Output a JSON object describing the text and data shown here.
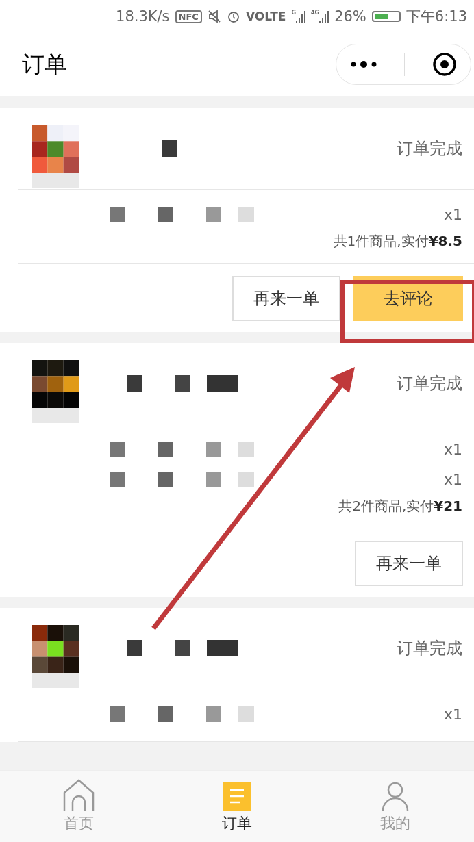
{
  "status_bar": {
    "speed": "18.3K/s",
    "nfc": "NFC",
    "volte": "VOLTE",
    "signals": [
      "G",
      "4G"
    ],
    "battery": "26%",
    "time": "下午6:13"
  },
  "header": {
    "title": "订单"
  },
  "orders": [
    {
      "status": "订单完成",
      "items": [
        {
          "qty": "x1"
        }
      ],
      "summary": "共1件商品,实付**¥8.5**",
      "buttons": [
        {
          "label": "再来一单",
          "kind": "outline"
        },
        {
          "label": "去评论",
          "kind": "primary"
        }
      ]
    },
    {
      "status": "订单完成",
      "items": [
        {
          "qty": "x1"
        },
        {
          "qty": "x1"
        }
      ],
      "summary": "共2件商品,实付**¥21**",
      "buttons": [
        {
          "label": "再来一单",
          "kind": "outline"
        }
      ]
    },
    {
      "status": "订单完成",
      "items": [
        {
          "qty": "x1"
        }
      ]
    }
  ],
  "tabs": [
    {
      "label": "首页",
      "selected": false
    },
    {
      "label": "订单",
      "selected": true
    },
    {
      "label": "我的",
      "selected": false
    }
  ]
}
